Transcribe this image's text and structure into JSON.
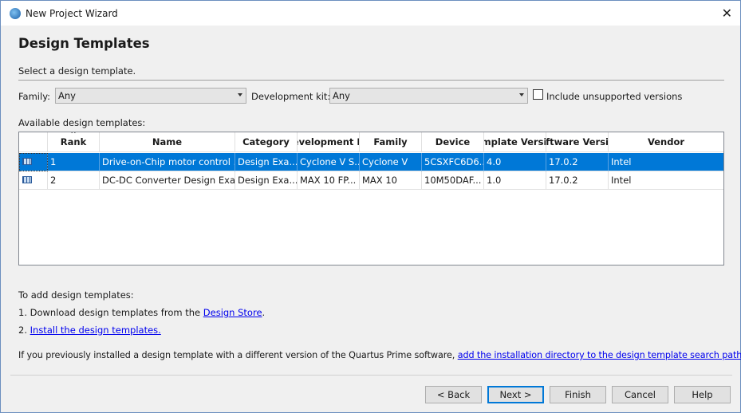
{
  "window": {
    "title": "New Project Wizard"
  },
  "page": {
    "heading": "Design Templates",
    "subtitle": "Select a design template."
  },
  "filters": {
    "family_label": "Family:",
    "family_value": "Any",
    "devkit_label": "Development kit:",
    "devkit_value": "Any",
    "include_unsupported_label": "Include unsupported versions",
    "include_unsupported_checked": false
  },
  "table": {
    "label": "Available design templates:",
    "columns": [
      "",
      "Rank",
      "Name",
      "Category",
      "Development Kit",
      "Family",
      "Device",
      "Template Version",
      "Software Version",
      "Vendor"
    ],
    "sorted_column": "Rank",
    "rows": [
      {
        "rank": "1",
        "name": "Drive-on-Chip motor control ...",
        "category": "Design Exa...",
        "devkit": "Cyclone V S...",
        "family": "Cyclone V",
        "device": "5CSXFC6D6...",
        "template_version": "4.0",
        "software_version": "17.0.2",
        "vendor": "Intel",
        "selected": true
      },
      {
        "rank": "2",
        "name": "DC-DC Converter Design Exa...",
        "category": "Design Exa...",
        "devkit": "MAX 10 FP...",
        "family": "MAX 10",
        "device": "10M50DAF...",
        "template_version": "1.0",
        "software_version": "17.0.2",
        "vendor": "Intel",
        "selected": false
      }
    ]
  },
  "help": {
    "intro": "To add design templates:",
    "step1_prefix": "1. Download design templates from the ",
    "step1_link": "Design Store",
    "step1_suffix": ".",
    "step2_prefix": "2. ",
    "step2_link": "Install the design templates.",
    "note_prefix": "If you previously installed a design template with a different version of the Quartus Prime software, ",
    "note_link": "add the installation directory to the design template search paths",
    "note_suffix": "."
  },
  "buttons": {
    "back": "< Back",
    "next": "Next >",
    "finish": "Finish",
    "cancel": "Cancel",
    "help": "Help"
  }
}
